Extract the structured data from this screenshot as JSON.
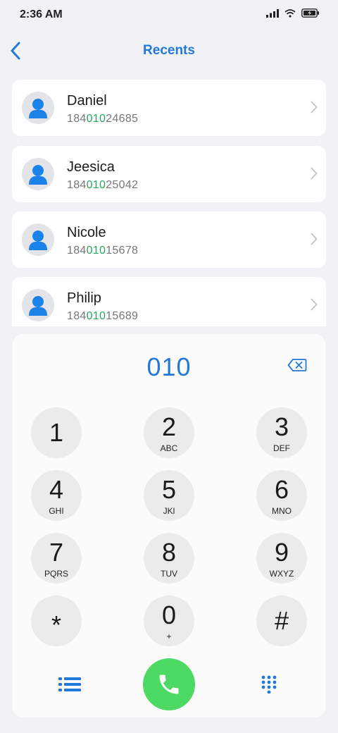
{
  "status": {
    "time": "2:36 AM"
  },
  "header": {
    "title": "Recents"
  },
  "recents": [
    {
      "name": "Daniel",
      "number_pre": "184",
      "number_match": "010",
      "number_post": "24685"
    },
    {
      "name": "Jeesica",
      "number_pre": "184",
      "number_match": "010",
      "number_post": "25042"
    },
    {
      "name": "Nicole",
      "number_pre": "184",
      "number_match": "010",
      "number_post": "15678"
    },
    {
      "name": "Philip",
      "number_pre": "184",
      "number_match": "010",
      "number_post": "15689"
    }
  ],
  "dialer": {
    "display": "010",
    "keys": [
      {
        "digit": "1",
        "letters": ""
      },
      {
        "digit": "2",
        "letters": "ABC"
      },
      {
        "digit": "3",
        "letters": "DEF"
      },
      {
        "digit": "4",
        "letters": "GHI"
      },
      {
        "digit": "5",
        "letters": "JKl"
      },
      {
        "digit": "6",
        "letters": "MNO"
      },
      {
        "digit": "7",
        "letters": "PQRS"
      },
      {
        "digit": "8",
        "letters": "TUV"
      },
      {
        "digit": "9",
        "letters": "WXYZ"
      },
      {
        "digit": "*",
        "letters": ""
      },
      {
        "digit": "0",
        "letters": "+"
      },
      {
        "digit": "#",
        "letters": ""
      }
    ]
  },
  "colors": {
    "accent": "#2479d8",
    "match": "#23a95a",
    "call": "#4cd964"
  },
  "icons": {
    "back": "chevron-left-icon",
    "delete": "backspace-icon",
    "list": "list-icon",
    "call": "phone-icon",
    "keypad": "keypad-icon"
  }
}
